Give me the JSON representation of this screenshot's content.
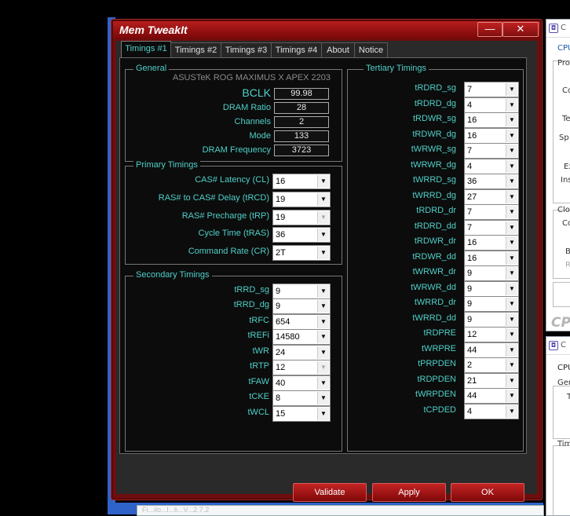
{
  "window": {
    "title": "Mem TweakIt",
    "min_label": "—",
    "close_label": "✕"
  },
  "tabs": [
    "Timings #1",
    "Timings #2",
    "Timings #3",
    "Timings #4",
    "About",
    "Notice"
  ],
  "general": {
    "title": "General",
    "board": "ASUSTeK ROG MAXIMUS X APEX 2203",
    "rows": [
      {
        "label": "BCLK",
        "value": "99.98"
      },
      {
        "label": "DRAM Ratio",
        "value": "28"
      },
      {
        "label": "Channels",
        "value": "2"
      },
      {
        "label": "Mode",
        "value": "133"
      },
      {
        "label": "DRAM Frequency",
        "value": "3723"
      }
    ]
  },
  "primary": {
    "title": "Primary Timings",
    "rows": [
      {
        "label": "CAS# Latency (CL)",
        "value": "16"
      },
      {
        "label": "RAS# to CAS# Delay (tRCD)",
        "value": "19"
      },
      {
        "label": "RAS# Precharge (tRP)",
        "value": "19"
      },
      {
        "label": "Cycle Time (tRAS)",
        "value": "36"
      },
      {
        "label": "Command Rate (CR)",
        "value": "2T"
      }
    ]
  },
  "secondary": {
    "title": "Secondary Timings",
    "rows": [
      {
        "label": "tRRD_sg",
        "value": "9"
      },
      {
        "label": "tRRD_dg",
        "value": "9"
      },
      {
        "label": "tRFC",
        "value": "654"
      },
      {
        "label": "tREFi",
        "value": "14580"
      },
      {
        "label": "tWR",
        "value": "24"
      },
      {
        "label": "tRTP",
        "value": "12"
      },
      {
        "label": "tFAW",
        "value": "40"
      },
      {
        "label": "tCKE",
        "value": "8"
      },
      {
        "label": "tWCL",
        "value": "15"
      }
    ]
  },
  "tertiary": {
    "title": "Tertiary Timings",
    "rows": [
      {
        "label": "tRDRD_sg",
        "value": "7"
      },
      {
        "label": "tRDRD_dg",
        "value": "4"
      },
      {
        "label": "tRDWR_sg",
        "value": "16"
      },
      {
        "label": "tRDWR_dg",
        "value": "16"
      },
      {
        "label": "tWRWR_sg",
        "value": "7"
      },
      {
        "label": "tWRWR_dg",
        "value": "4"
      },
      {
        "label": "tWRRD_sg",
        "value": "36"
      },
      {
        "label": "tWRRD_dg",
        "value": "27"
      },
      {
        "label": "tRDRD_dr",
        "value": "7"
      },
      {
        "label": "tRDRD_dd",
        "value": "7"
      },
      {
        "label": "tRDWR_dr",
        "value": "16"
      },
      {
        "label": "tRDWR_dd",
        "value": "16"
      },
      {
        "label": "tWRWR_dr",
        "value": "9"
      },
      {
        "label": "tWRWR_dd",
        "value": "9"
      },
      {
        "label": "tWRRD_dr",
        "value": "9"
      },
      {
        "label": "tWRRD_dd",
        "value": "9"
      },
      {
        "label": "tRDPRE",
        "value": "12"
      },
      {
        "label": "tWRPRE",
        "value": "44"
      },
      {
        "label": "tPRPDEN",
        "value": "2"
      },
      {
        "label": "tRDPDEN",
        "value": "21"
      },
      {
        "label": "tWRPDEN",
        "value": "44"
      },
      {
        "label": "tCPDED",
        "value": "4"
      }
    ]
  },
  "buttons": {
    "validate": "Validate",
    "apply": "Apply",
    "ok": "OK"
  },
  "bg_windows": {
    "top": {
      "title": "C",
      "tab": "CPU",
      "lines": [
        "Pro",
        "Co",
        "Te",
        "Sp",
        "Ex",
        "Ins",
        "Clo",
        "Co",
        "B",
        "R"
      ],
      "big": "CP"
    },
    "bottom": {
      "title": "C",
      "tab": "CPU",
      "lines": [
        "Gen",
        "T",
        "Tim"
      ]
    },
    "taskbar_text": "Fi...ilo...l...li...V...2.7.2"
  }
}
